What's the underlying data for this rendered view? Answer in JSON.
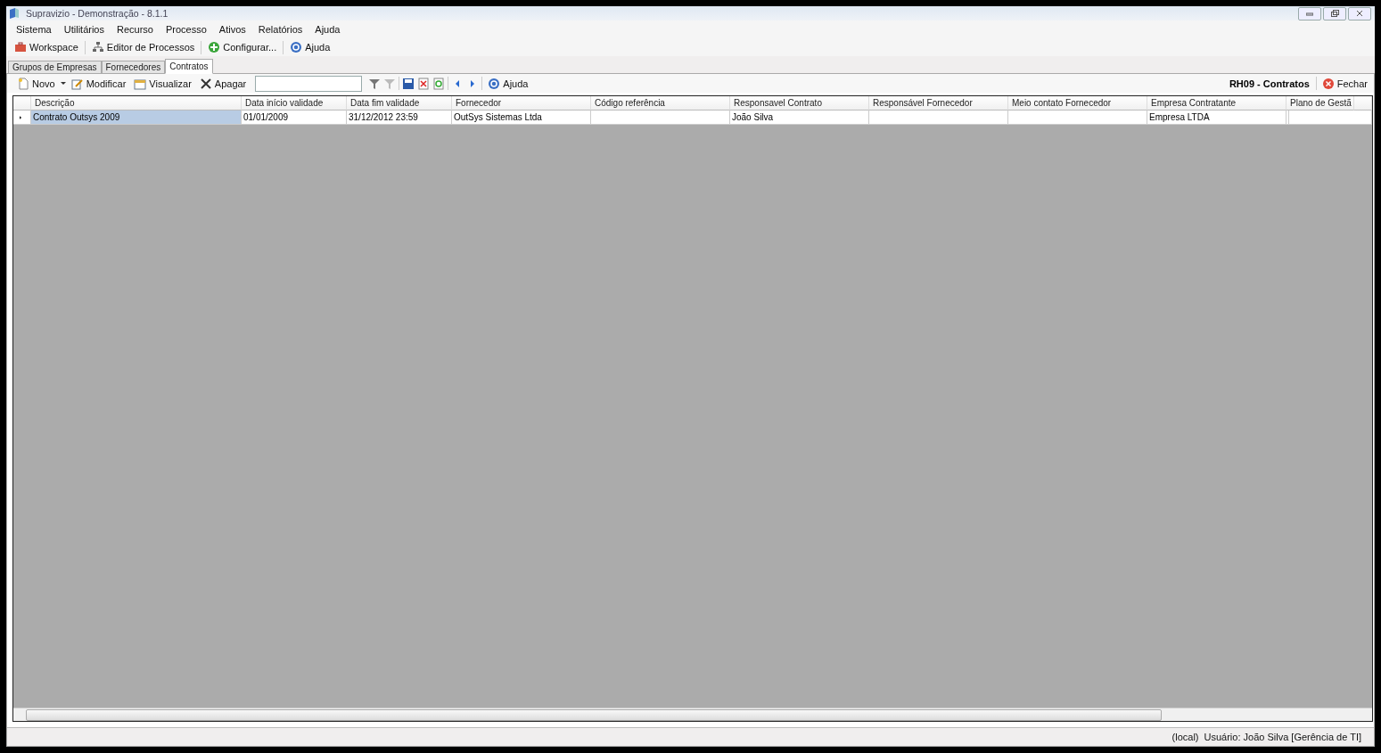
{
  "window": {
    "title": "Supravizio - Demonstração - 8.1.1"
  },
  "menu": [
    "Sistema",
    "Utilitários",
    "Recurso",
    "Processo",
    "Ativos",
    "Relatórios",
    "Ajuda"
  ],
  "toolbar": [
    "Workspace",
    "Editor de Processos",
    "Configurar...",
    "Ajuda"
  ],
  "tabs": [
    {
      "label": "Grupos de Empresas",
      "selected": false
    },
    {
      "label": "Fornecedores",
      "selected": false
    },
    {
      "label": "Contratos",
      "selected": true
    }
  ],
  "grid_toolbar": {
    "new": "Novo",
    "edit": "Modificar",
    "view": "Visualizar",
    "delete": "Apagar",
    "help": "Ajuda",
    "title": "RH09 - Contratos",
    "close": "Fechar"
  },
  "table": {
    "columns": [
      "Descrição",
      "Data início validade",
      "Data fim validade",
      "Fornecedor",
      "Código referência",
      "Responsavel Contrato",
      "Responsável Fornecedor",
      "Meio contato Fornecedor",
      "Empresa Contratante",
      "Plano de Gestã"
    ],
    "rows": [
      {
        "selected": true,
        "cells": [
          "Contrato Outsys 2009",
          "01/01/2009",
          "31/12/2012 23:59",
          "OutSys Sistemas Ltda",
          "",
          "João Silva",
          "",
          "",
          "Empresa LTDA",
          ""
        ]
      }
    ]
  },
  "status_bar": [
    "(local)",
    "Usuário: João Silva [Gerência de TI]"
  ]
}
